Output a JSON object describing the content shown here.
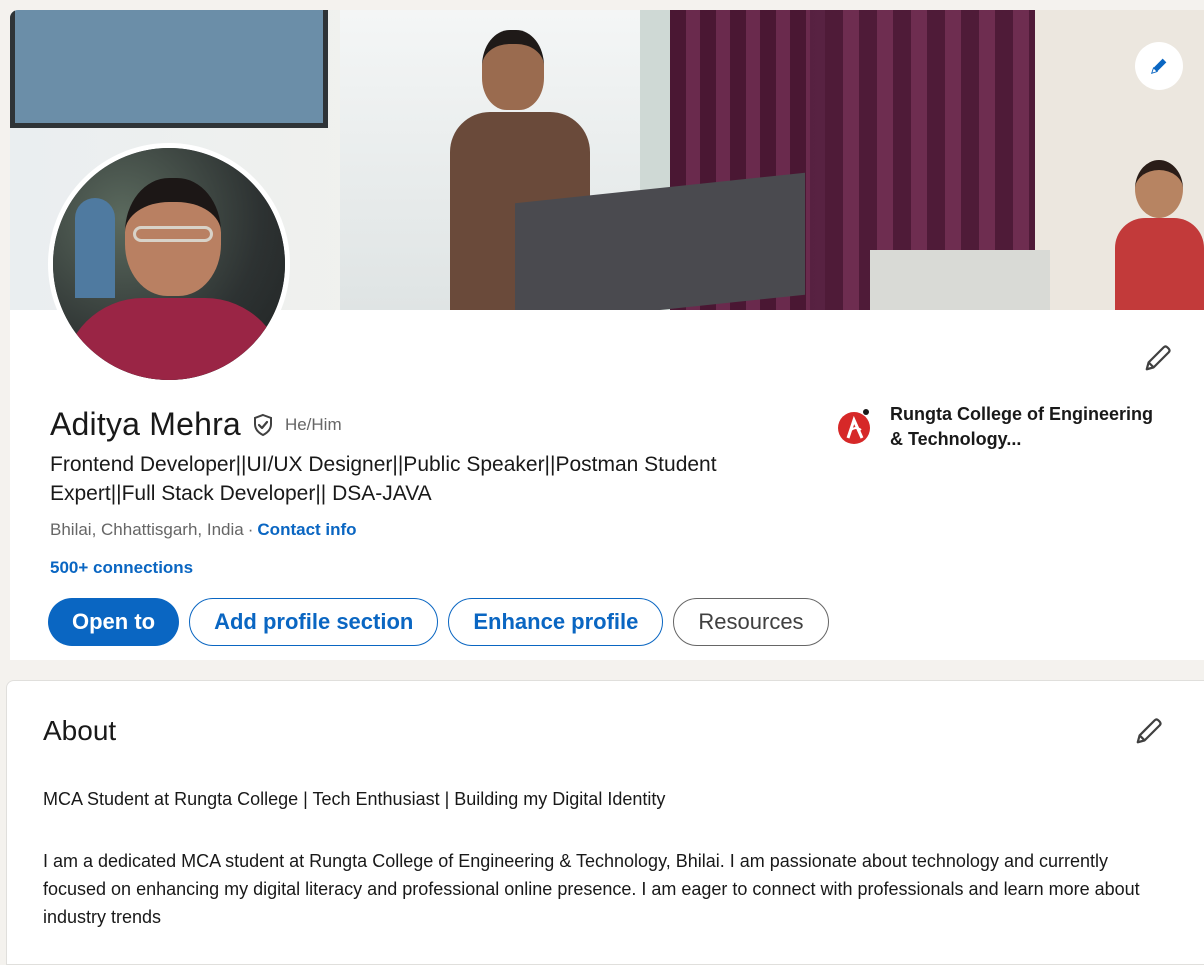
{
  "profile": {
    "name": "Aditya Mehra",
    "pronouns": "He/Him",
    "headline": "Frontend Developer||UI/UX Designer||Public Speaker||Postman Student Expert||Full Stack Developer|| DSA-JAVA",
    "location": "Bhilai, Chhattisgarh, India",
    "separator": "·",
    "contact_info_label": "Contact info",
    "connections": "500+ connections",
    "verified_icon": "verified-shield-icon",
    "education": {
      "name": "Rungta College of Engineering & Technology...",
      "logo_color": "#d62828"
    }
  },
  "actions": {
    "open_to": "Open to",
    "add_profile_section": "Add profile section",
    "enhance_profile": "Enhance profile",
    "resources": "Resources"
  },
  "about": {
    "title": "About",
    "summary": "MCA Student at Rungta College | Tech Enthusiast | Building my Digital Identity",
    "body": "I am a dedicated MCA student at Rungta College of Engineering & Technology, Bhilai. I am passionate about technology and currently focused on enhancing my digital literacy and professional online presence. I am eager to connect with professionals and learn more about industry trends"
  },
  "colors": {
    "accent": "#0a66c2",
    "text": "#191919",
    "muted": "#666666"
  }
}
